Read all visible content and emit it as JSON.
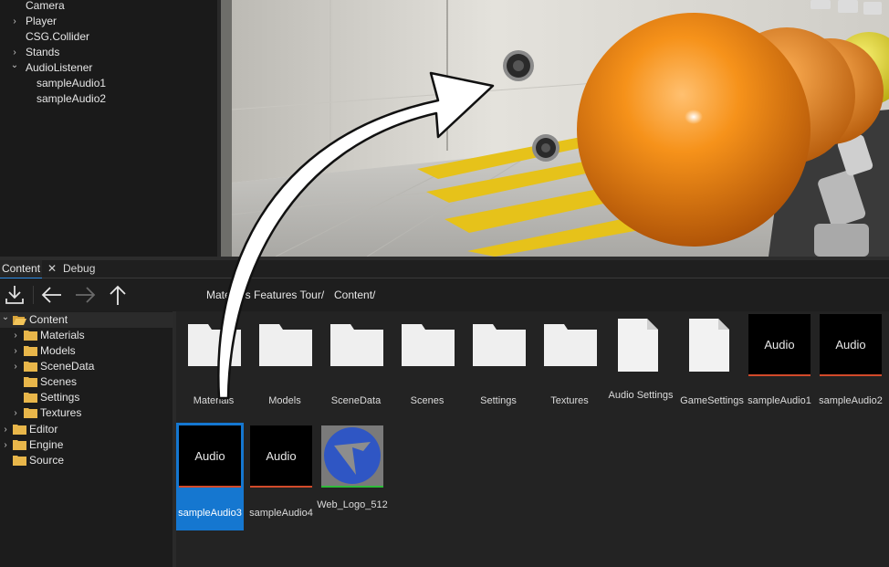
{
  "scene_tree": {
    "items": [
      {
        "label": "Camera",
        "arrow": ""
      },
      {
        "label": "Player",
        "arrow": "›"
      },
      {
        "label": "CSG.Collider",
        "arrow": ""
      },
      {
        "label": "Stands",
        "arrow": "›"
      },
      {
        "label": "AudioListener",
        "arrow": "⌄"
      },
      {
        "label": "sampleAudio1",
        "arrow": ""
      },
      {
        "label": "sampleAudio2",
        "arrow": ""
      }
    ]
  },
  "tabs": {
    "content": "Content",
    "close": "✕",
    "debug": "Debug"
  },
  "toolbar": {
    "breadcrumb_1": "Materials Features Tour/",
    "breadcrumb_2": "Content/"
  },
  "content_tree": {
    "root": "Content",
    "children": [
      "Materials",
      "Models",
      "SceneData",
      "Scenes",
      "Settings",
      "Textures"
    ],
    "others": [
      "Editor",
      "Engine",
      "Source"
    ]
  },
  "assets": {
    "thumb_text": "Audio",
    "items": [
      {
        "label": "Materials",
        "kind": "folder"
      },
      {
        "label": "Models",
        "kind": "folder"
      },
      {
        "label": "SceneData",
        "kind": "folder"
      },
      {
        "label": "Scenes",
        "kind": "folder"
      },
      {
        "label": "Settings",
        "kind": "folder"
      },
      {
        "label": "Textures",
        "kind": "folder"
      },
      {
        "label": "Audio Settings",
        "kind": "file"
      },
      {
        "label": "GameSettings",
        "kind": "file"
      },
      {
        "label": "sampleAudio1",
        "kind": "audio"
      },
      {
        "label": "sampleAudio2",
        "kind": "audio"
      },
      {
        "label": "sampleAudio3",
        "kind": "audio",
        "selected": true
      },
      {
        "label": "sampleAudio4",
        "kind": "audio"
      },
      {
        "label": "Web_Logo_512",
        "kind": "image"
      }
    ]
  },
  "colors": {
    "accent": "#1577d0",
    "audio_bar": "#d24a2a",
    "image_bar": "#2dbb3a",
    "sphere": "#f08a12"
  }
}
